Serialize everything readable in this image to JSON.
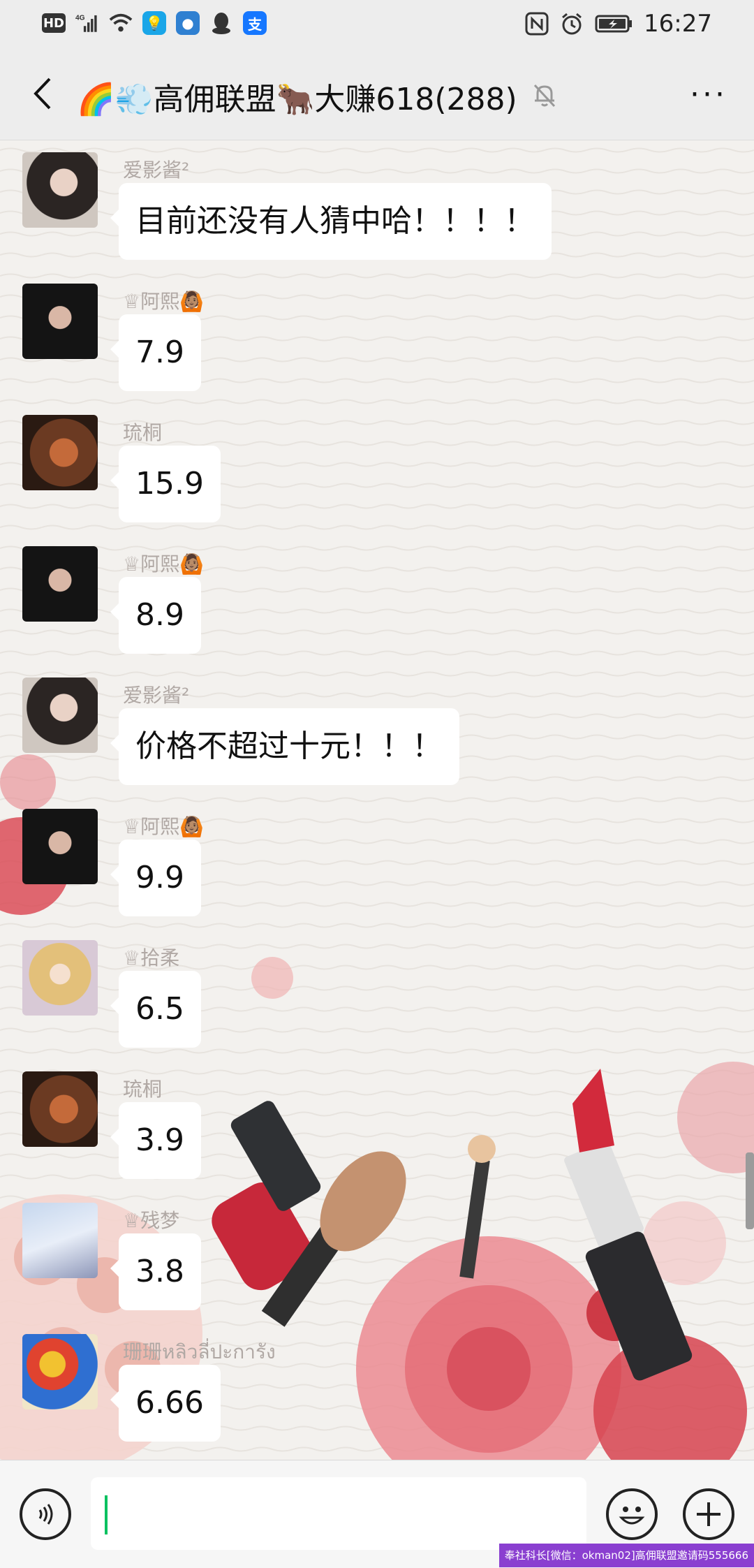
{
  "status_bar": {
    "network": "HD",
    "signal": "4G",
    "time": "16:27",
    "icons": [
      "hd-icon",
      "signal-icon",
      "wifi-icon",
      "bulb-app-icon",
      "robot-app-icon",
      "qq-icon",
      "alipay-icon",
      "nfc-icon",
      "alarm-icon",
      "battery-icon"
    ],
    "alipay_glyph": "支"
  },
  "header": {
    "title": "🌈💨高佣联盟🐂大赚618(288)",
    "more_label": "···"
  },
  "messages": [
    {
      "sender": "爱影酱²",
      "text": "目前还没有人猜中哈！！！！",
      "avatar": "avatar-girl-dark-hair"
    },
    {
      "sender": "♕阿熙🙆🏽",
      "text": "7.9",
      "avatar": "avatar-girl-hand-face"
    },
    {
      "sender": "琉桐",
      "text": "15.9",
      "avatar": "avatar-girl-warm-light"
    },
    {
      "sender": "♕阿熙🙆🏽",
      "text": "8.9",
      "avatar": "avatar-girl-hand-face"
    },
    {
      "sender": "爱影酱²",
      "text": "价格不超过十元！！！",
      "avatar": "avatar-girl-dark-hair"
    },
    {
      "sender": "♕阿熙🙆🏽",
      "text": "9.9",
      "avatar": "avatar-girl-hand-face"
    },
    {
      "sender": "♕拾柔",
      "text": "6.5",
      "avatar": "avatar-anime-blonde"
    },
    {
      "sender": "琉桐",
      "text": "3.9",
      "avatar": "avatar-girl-warm-light"
    },
    {
      "sender": "♕残梦",
      "text": "3.8",
      "avatar": "avatar-girl-sitting"
    },
    {
      "sender": "珊珊หลิวลี่ปะการัง",
      "text": "6.66",
      "avatar": "avatar-artwork-colorful"
    }
  ],
  "input": {
    "value": "",
    "placeholder": ""
  },
  "watermark": "奉社科长[微信：okman02]高佣联盟邀请码555666",
  "colors": {
    "bar_bg": "#ededed",
    "bubble": "#ffffff",
    "cursor": "#07c160",
    "sender_text": "#b0a8a4"
  }
}
